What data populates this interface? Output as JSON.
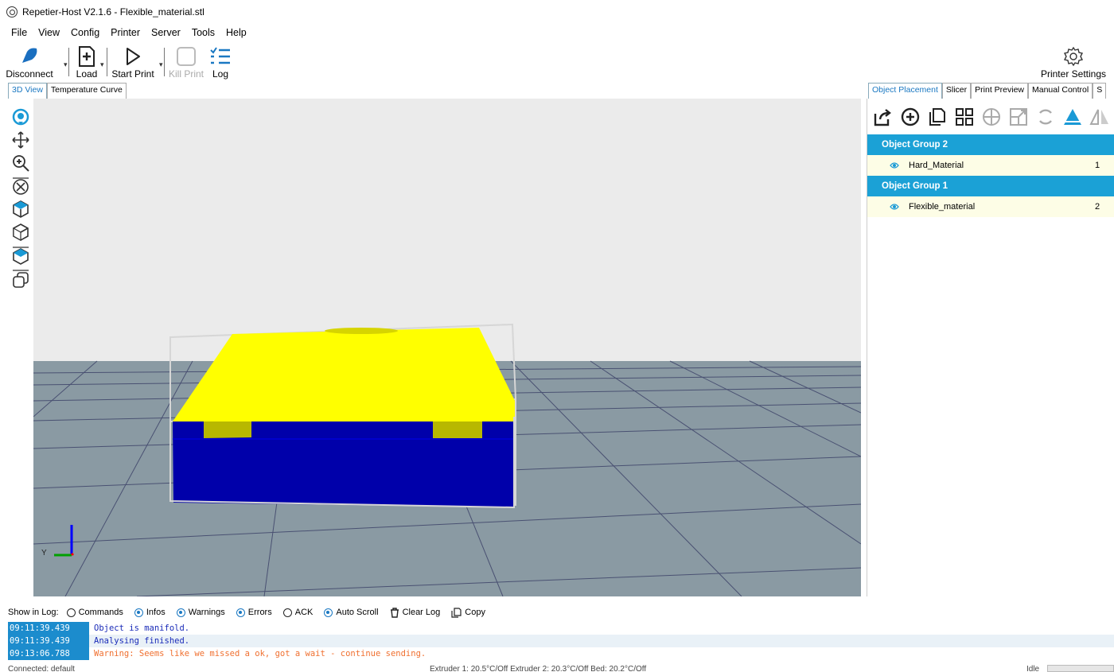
{
  "window": {
    "title": "Repetier-Host V2.1.6 - Flexible_material.stl"
  },
  "menu": [
    "File",
    "View",
    "Config",
    "Printer",
    "Server",
    "Tools",
    "Help"
  ],
  "toolbar": {
    "disconnect": "Disconnect",
    "load": "Load",
    "start_print": "Start Print",
    "kill_print": "Kill Print",
    "log": "Log",
    "printer_settings": "Printer Settings"
  },
  "left_tabs": [
    "3D View",
    "Temperature Curve"
  ],
  "right_tabs": [
    "Object Placement",
    "Slicer",
    "Print Preview",
    "Manual Control",
    "S"
  ],
  "object_groups": [
    {
      "name": "Object Group 2",
      "objects": [
        {
          "name": "Hard_Material",
          "count": "1"
        }
      ]
    },
    {
      "name": "Object Group 1",
      "objects": [
        {
          "name": "Flexible_material",
          "count": "2"
        }
      ]
    }
  ],
  "axis": {
    "y": "Y"
  },
  "log_options": {
    "label": "Show in Log:",
    "items": [
      {
        "label": "Commands",
        "checked": false
      },
      {
        "label": "Infos",
        "checked": true
      },
      {
        "label": "Warnings",
        "checked": true
      },
      {
        "label": "Errors",
        "checked": true
      },
      {
        "label": "ACK",
        "checked": false
      },
      {
        "label": "Auto Scroll",
        "checked": true
      }
    ],
    "clear_log": "Clear Log",
    "copy": "Copy"
  },
  "log": [
    {
      "time": "09:11:39.439",
      "message": "Object is manifold.",
      "type": "info"
    },
    {
      "time": "09:11:39.439",
      "message": "Analysing finished.",
      "type": "info"
    },
    {
      "time": "09:13:06.788",
      "message": "Warning: Seems like we missed a ok, got a wait - continue sending.",
      "type": "warn"
    }
  ],
  "status": {
    "connection": "Connected: default",
    "temps": "Extruder 1: 20.5°C/Off Extruder 2: 20.3°C/Off Bed: 20.2°C/Off",
    "state": "Idle"
  },
  "colors": {
    "accent": "#1ba1d6",
    "model_top": "#ffff00",
    "model_base": "#0000aa",
    "bed": "#8a9aa3",
    "warning": "#f07030",
    "info": "#1a2bb8"
  }
}
